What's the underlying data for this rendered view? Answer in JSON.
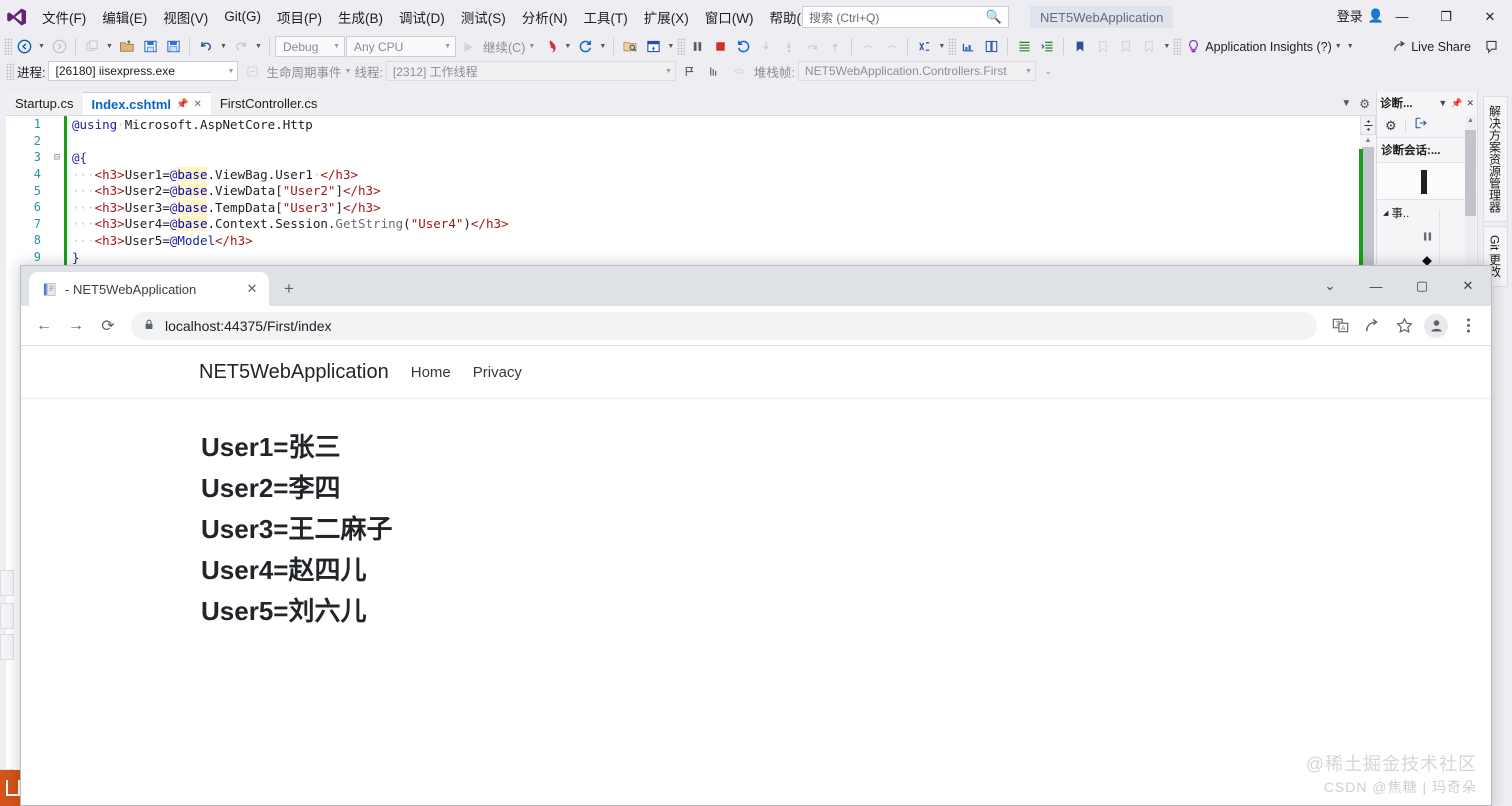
{
  "vs": {
    "menu": [
      "文件(F)",
      "编辑(E)",
      "视图(V)",
      "Git(G)",
      "项目(P)",
      "生成(B)",
      "调试(D)",
      "测试(S)",
      "分析(N)",
      "工具(T)",
      "扩展(X)",
      "窗口(W)",
      "帮助(H)"
    ],
    "search_placeholder": "搜索 (Ctrl+Q)",
    "app_title": "NET5WebApplication",
    "signin_label": "登录",
    "window_buttons": {
      "minimize": "—",
      "restore": "❐",
      "close": "✕"
    },
    "toolbar": {
      "config": "Debug",
      "platform": "Any CPU",
      "continue_label": "继续(C)",
      "app_insights_label": "Application Insights (?)",
      "live_share_label": "Live Share"
    },
    "debugbar": {
      "process_label": "进程:",
      "process_value": "[26180] iisexpress.exe",
      "lifecycle_label": "生命周期事件",
      "thread_label": "线程:",
      "thread_value": "[2312] 工作线程",
      "stack_label": "堆栈帧:",
      "stack_value": "NET5WebApplication.Controllers.First"
    },
    "tabs": [
      {
        "label": "Startup.cs",
        "active": false
      },
      {
        "label": "Index.cshtml",
        "active": true
      },
      {
        "label": "FirstController.cs",
        "active": false
      }
    ],
    "code_lines": [
      {
        "n": "1",
        "changed": true,
        "fold": "",
        "tokens": [
          {
            "t": "@using",
            "c": "k-razor"
          },
          {
            "t": "·",
            "c": "k-ws"
          },
          {
            "t": "Microsoft.AspNetCore.Http",
            "c": "k-plain"
          }
        ]
      },
      {
        "n": "2",
        "changed": true,
        "fold": "",
        "tokens": []
      },
      {
        "n": "3",
        "changed": true,
        "fold": "⊟",
        "tokens": [
          {
            "t": "@{",
            "c": "k-razor"
          }
        ]
      },
      {
        "n": "4",
        "changed": true,
        "fold": "",
        "tokens": [
          {
            "t": "···",
            "c": "k-ws"
          },
          {
            "t": "<h3>",
            "c": "k-tag"
          },
          {
            "t": "User1=",
            "c": "k-plain"
          },
          {
            "t": "@",
            "c": "k-razor"
          },
          {
            "t": "base",
            "c": "k-kw"
          },
          {
            "t": ".ViewBag.User1",
            "c": "k-plain"
          },
          {
            "t": "·",
            "c": "k-ws"
          },
          {
            "t": "</h3>",
            "c": "k-tag"
          }
        ]
      },
      {
        "n": "5",
        "changed": true,
        "fold": "",
        "tokens": [
          {
            "t": "···",
            "c": "k-ws"
          },
          {
            "t": "<h3>",
            "c": "k-tag"
          },
          {
            "t": "User2=",
            "c": "k-plain"
          },
          {
            "t": "@",
            "c": "k-razor"
          },
          {
            "t": "base",
            "c": "k-kw"
          },
          {
            "t": ".ViewData[",
            "c": "k-plain"
          },
          {
            "t": "\"User2\"",
            "c": "k-str"
          },
          {
            "t": "]",
            "c": "k-plain"
          },
          {
            "t": "</h3>",
            "c": "k-tag"
          }
        ]
      },
      {
        "n": "6",
        "changed": true,
        "fold": "",
        "tokens": [
          {
            "t": "···",
            "c": "k-ws"
          },
          {
            "t": "<h3>",
            "c": "k-tag"
          },
          {
            "t": "User3=",
            "c": "k-plain"
          },
          {
            "t": "@",
            "c": "k-razor"
          },
          {
            "t": "base",
            "c": "k-kw"
          },
          {
            "t": ".TempData[",
            "c": "k-plain"
          },
          {
            "t": "\"User3\"",
            "c": "k-str"
          },
          {
            "t": "]",
            "c": "k-plain"
          },
          {
            "t": "</h3>",
            "c": "k-tag"
          }
        ]
      },
      {
        "n": "7",
        "changed": true,
        "fold": "",
        "tokens": [
          {
            "t": "···",
            "c": "k-ws"
          },
          {
            "t": "<h3>",
            "c": "k-tag"
          },
          {
            "t": "User4=",
            "c": "k-plain"
          },
          {
            "t": "@",
            "c": "k-razor"
          },
          {
            "t": "base",
            "c": "k-kw"
          },
          {
            "t": ".Context.Session.",
            "c": "k-plain"
          },
          {
            "t": "GetString",
            "c": "k-meth"
          },
          {
            "t": "(",
            "c": "k-plain"
          },
          {
            "t": "\"User4\"",
            "c": "k-str"
          },
          {
            "t": ")",
            "c": "k-plain"
          },
          {
            "t": "</h3>",
            "c": "k-tag"
          }
        ]
      },
      {
        "n": "8",
        "changed": true,
        "fold": "",
        "tokens": [
          {
            "t": "···",
            "c": "k-ws"
          },
          {
            "t": "<h3>",
            "c": "k-tag"
          },
          {
            "t": "User5=",
            "c": "k-plain"
          },
          {
            "t": "@Model",
            "c": "k-razor"
          },
          {
            "t": "</h3>",
            "c": "k-tag"
          }
        ]
      },
      {
        "n": "9",
        "changed": true,
        "fold": "",
        "tokens": [
          {
            "t": "}",
            "c": "k-razor"
          }
        ]
      }
    ],
    "diagnostics": {
      "title": "诊断...",
      "session_label": "诊断会话:...",
      "events_label": "事..",
      "pin": "📌",
      "close": "✕"
    },
    "dock_right": [
      "解决方案资源管理器",
      "Git 更改"
    ]
  },
  "browser": {
    "tab_title": "- NET5WebApplication",
    "tab_close": "✕",
    "new_tab": "+",
    "window_buttons": {
      "more": "⌄",
      "minimize": "—",
      "maximize": "▢",
      "close": "✕"
    },
    "nav": {
      "back": "←",
      "forward": "→",
      "reload": "⟳"
    },
    "url": "localhost:44375/First/index",
    "lock_icon": "lock",
    "toolbar_icons": [
      "translate-icon",
      "share-icon",
      "bookmark-icon",
      "profile-icon",
      "menu-icon"
    ]
  },
  "site": {
    "brand": "NET5WebApplication",
    "links": [
      "Home",
      "Privacy"
    ],
    "users": [
      "User1=张三",
      "User2=李四",
      "User3=王二麻子",
      "User4=赵四儿",
      "User5=刘六儿"
    ]
  },
  "watermark": {
    "line1": "@稀土掘金技术社区",
    "line2": "CSDN @焦糖 | 玛奇朵"
  }
}
